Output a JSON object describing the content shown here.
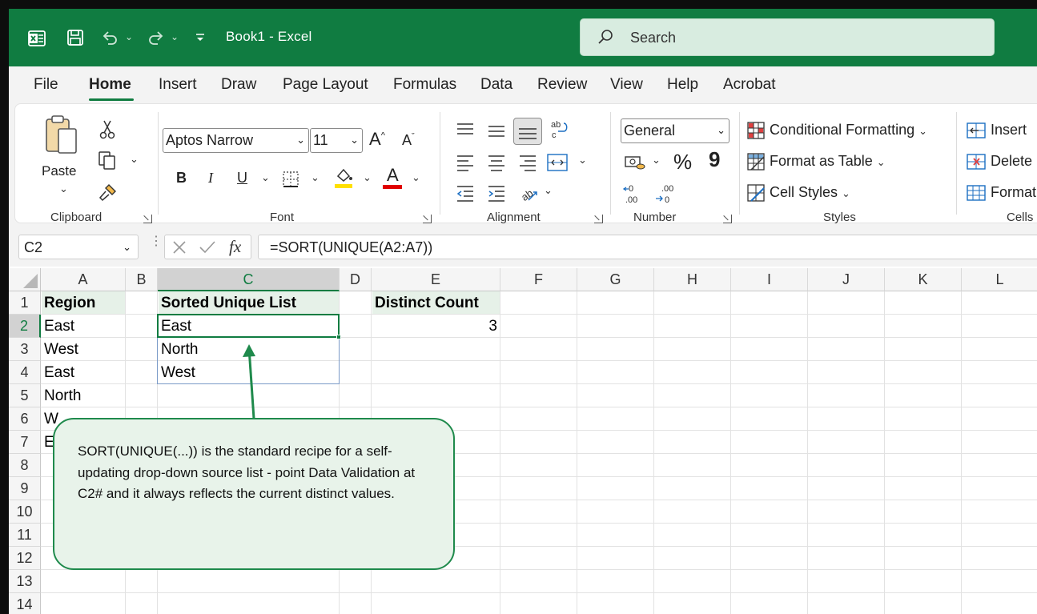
{
  "app": {
    "title": "Book1  -  Excel",
    "search_placeholder": "Search",
    "colors": {
      "brand": "#107c41",
      "search_bg": "#d8ece0",
      "header_fill": "#e6f1e8",
      "callout_border": "#1f8a4c"
    }
  },
  "ribbon": {
    "tabs": [
      "File",
      "Home",
      "Insert",
      "Draw",
      "Page Layout",
      "Formulas",
      "Data",
      "Review",
      "View",
      "Help",
      "Acrobat"
    ],
    "active_tab": "Home",
    "clipboard": {
      "label": "Clipboard",
      "paste": "Paste"
    },
    "font": {
      "label": "Font",
      "family": "Aptos Narrow",
      "size": "11",
      "bold": "B",
      "italic": "I",
      "underline": "U",
      "font_color_glyph": "A"
    },
    "alignment": {
      "label": "Alignment"
    },
    "number": {
      "label": "Number",
      "format": "General",
      "percent": "%",
      "comma": "9"
    },
    "styles": {
      "label": "Styles",
      "conditional": "Conditional Formatting",
      "format_table": "Format as Table",
      "cell_styles": "Cell Styles"
    },
    "cells": {
      "label": "Cells",
      "insert": "Insert",
      "delete": "Delete",
      "format": "Format"
    }
  },
  "formula_bar": {
    "name_box": "C2",
    "fx": "fx",
    "formula": "=SORT(UNIQUE(A2:A7))"
  },
  "sheet": {
    "columns": [
      "A",
      "B",
      "C",
      "D",
      "E",
      "F",
      "G",
      "H",
      "I",
      "J",
      "K",
      "L"
    ],
    "rows": [
      "1",
      "2",
      "3",
      "4",
      "5",
      "6",
      "7",
      "8",
      "9",
      "10",
      "11",
      "12",
      "13",
      "14"
    ],
    "selected_column": "C",
    "selected_row": "2",
    "cells": {
      "A1": "Region",
      "A2": "East",
      "A3": "West",
      "A4": "East",
      "A5": "North",
      "A6": "W",
      "A7": "E",
      "C1": "Sorted Unique List",
      "C2": "East",
      "C3": "North",
      "C4": "West",
      "E1": "Distinct Count",
      "E2": "3"
    }
  },
  "callout": {
    "text": "SORT(UNIQUE(...)) is the standard recipe for a self-updating drop-down source list - point Data Validation at C2# and it always reflects the current distinct values."
  }
}
